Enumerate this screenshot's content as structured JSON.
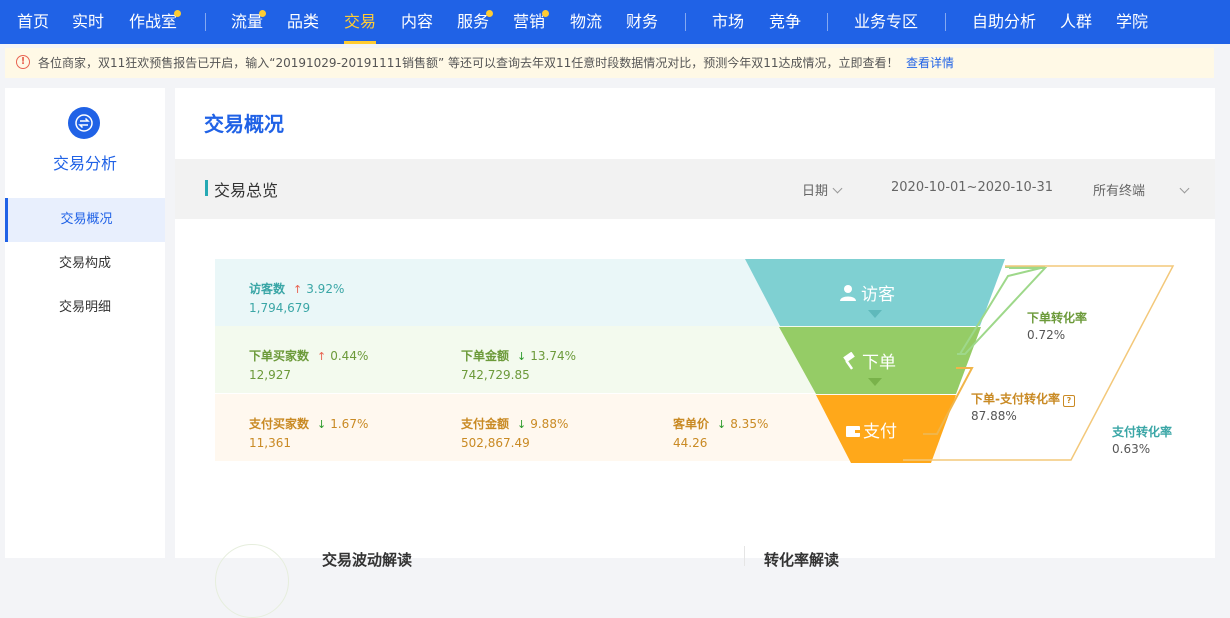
{
  "nav": {
    "items": [
      {
        "label": "首页"
      },
      {
        "label": "实时"
      },
      {
        "label": "作战室"
      },
      {
        "label": "流量"
      },
      {
        "label": "品类"
      },
      {
        "label": "交易"
      },
      {
        "label": "内容"
      },
      {
        "label": "服务"
      },
      {
        "label": "营销"
      },
      {
        "label": "物流"
      },
      {
        "label": "财务"
      },
      {
        "label": "市场"
      },
      {
        "label": "竞争"
      },
      {
        "label": "业务专区"
      },
      {
        "label": "自助分析"
      },
      {
        "label": "人群"
      },
      {
        "label": "学院"
      }
    ]
  },
  "notice": {
    "text": "各位商家，双11狂欢预售报告已开启，输入“20191029-20191111销售额” 等还可以查询去年双11任意时段数据情况对比，预测今年双11达成情况，立即查看！",
    "link": "查看详情"
  },
  "sidebar": {
    "title": "交易分析",
    "items": [
      {
        "label": "交易概况"
      },
      {
        "label": "交易构成"
      },
      {
        "label": "交易明细"
      }
    ]
  },
  "main": {
    "title": "交易概况",
    "section_title": "交易总览",
    "filters": {
      "date_label": "日期",
      "date_range": "2020-10-01~2020-10-31",
      "terminal": "所有终端"
    }
  },
  "funnel": {
    "stages": {
      "visitor": "访客",
      "order": "下单",
      "pay": "支付"
    },
    "rows": [
      {
        "metrics": [
          {
            "label": "访客数",
            "trend": "up",
            "delta": "3.92%",
            "value": "1,794,679"
          }
        ]
      },
      {
        "metrics": [
          {
            "label": "下单买家数",
            "trend": "up",
            "delta": "0.44%",
            "value": "12,927"
          },
          {
            "label": "下单金额",
            "trend": "down",
            "delta": "13.74%",
            "value": "742,729.85"
          }
        ]
      },
      {
        "metrics": [
          {
            "label": "支付买家数",
            "trend": "down",
            "delta": "1.67%",
            "value": "11,361"
          },
          {
            "label": "支付金额",
            "trend": "down",
            "delta": "9.88%",
            "value": "502,867.49"
          },
          {
            "label": "客单价",
            "trend": "down",
            "delta": "8.35%",
            "value": "44.26"
          }
        ]
      }
    ],
    "rates": {
      "order_rate": {
        "label": "下单转化率",
        "value": "0.72%"
      },
      "order_pay_rate": {
        "label": "下单-支付转化率",
        "value": "87.88%"
      },
      "pay_rate": {
        "label": "支付转化率",
        "value": "0.63%"
      }
    }
  },
  "bottom": {
    "left_heading": "交易波动解读",
    "right_heading": "转化率解读"
  },
  "colors": {
    "primary": "#2062e6",
    "active_nav": "#ffcc33",
    "visitor": "#7fd0d2",
    "order": "#95cc66",
    "pay": "#ffa81a"
  }
}
